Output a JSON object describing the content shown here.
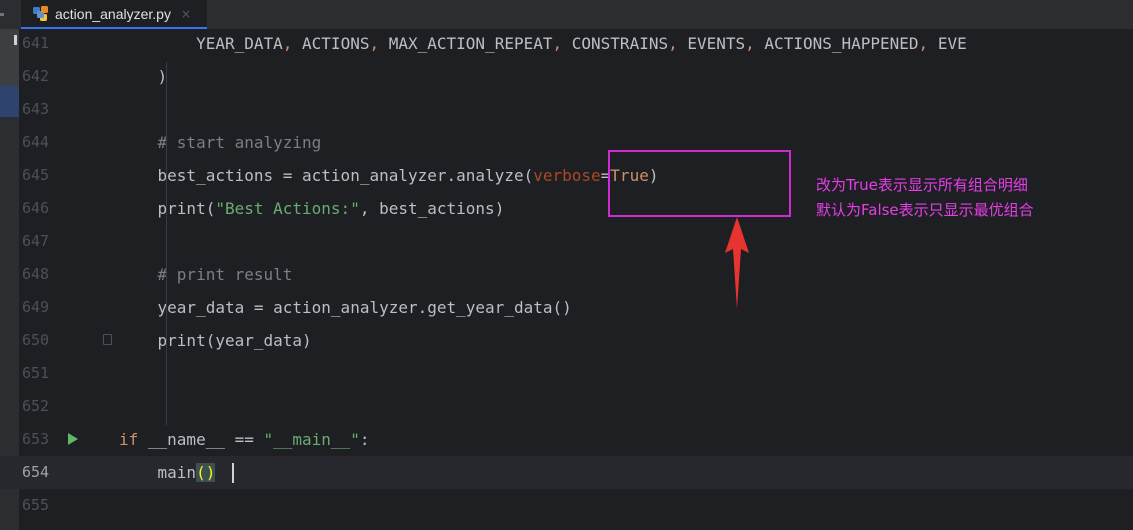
{
  "tab": {
    "label": "action_analyzer.py",
    "close": "×",
    "icon": "python-file-icon"
  },
  "lines": [
    {
      "num": "641",
      "parts": [
        {
          "t": "        YEAR_DATA",
          "c": ""
        },
        {
          "t": ", ",
          "c": "kw"
        },
        {
          "t": "ACTIONS",
          "c": ""
        },
        {
          "t": ", ",
          "c": "kw"
        },
        {
          "t": "MAX_ACTION_REPEAT",
          "c": ""
        },
        {
          "t": ", ",
          "c": "kw"
        },
        {
          "t": "CONSTRAINS",
          "c": ""
        },
        {
          "t": ", ",
          "c": "kw"
        },
        {
          "t": "EVENTS",
          "c": ""
        },
        {
          "t": ", ",
          "c": "kw"
        },
        {
          "t": "ACTIONS_HAPPENED",
          "c": ""
        },
        {
          "t": ", ",
          "c": "kw"
        },
        {
          "t": "EVE",
          "c": ""
        }
      ]
    },
    {
      "num": "642",
      "parts": [
        {
          "t": "    )",
          "c": ""
        }
      ]
    },
    {
      "num": "643",
      "parts": []
    },
    {
      "num": "644",
      "parts": [
        {
          "t": "    # start analyzing",
          "c": "cmt"
        }
      ]
    },
    {
      "num": "645",
      "parts": [
        {
          "t": "    best_actions = action_analyzer.analyze(",
          "c": ""
        },
        {
          "t": "verbose",
          "c": "param"
        },
        {
          "t": "=",
          "c": ""
        },
        {
          "t": "True",
          "c": "kw"
        },
        {
          "t": ")",
          "c": ""
        }
      ]
    },
    {
      "num": "646",
      "parts": [
        {
          "t": "    print(",
          "c": ""
        },
        {
          "t": "\"Best Actions:\"",
          "c": "str"
        },
        {
          "t": ", best_actions)",
          "c": ""
        }
      ]
    },
    {
      "num": "647",
      "parts": []
    },
    {
      "num": "648",
      "parts": [
        {
          "t": "    # print result",
          "c": "cmt"
        }
      ]
    },
    {
      "num": "649",
      "parts": [
        {
          "t": "    year_data = action_analyzer.get_year_data()",
          "c": ""
        }
      ]
    },
    {
      "num": "650",
      "parts": [
        {
          "t": "    print(year_data)",
          "c": ""
        }
      ]
    },
    {
      "num": "651",
      "parts": []
    },
    {
      "num": "652",
      "parts": []
    },
    {
      "num": "653",
      "parts": [
        {
          "t": "if",
          "c": "kw"
        },
        {
          "t": " __name__ ",
          "c": ""
        },
        {
          "t": "==",
          "c": ""
        },
        {
          "t": " \"__main__\"",
          "c": "str"
        },
        {
          "t": ":",
          "c": ""
        }
      ]
    },
    {
      "num": "654",
      "parts": [
        {
          "t": "    main",
          "c": ""
        },
        {
          "t": "()",
          "c": "paren-hl"
        }
      ]
    },
    {
      "num": "655",
      "parts": []
    }
  ],
  "current_line": "654",
  "annotation": {
    "note_line1": "改为True表示显示所有组合明细",
    "note_line2": "默认为False表示只显示最优组合",
    "color": "#e63ee8"
  },
  "colors": {
    "background": "#1e1f22",
    "keyword": "#cf8e6d",
    "string": "#6aab73",
    "comment": "#7a7e85"
  }
}
